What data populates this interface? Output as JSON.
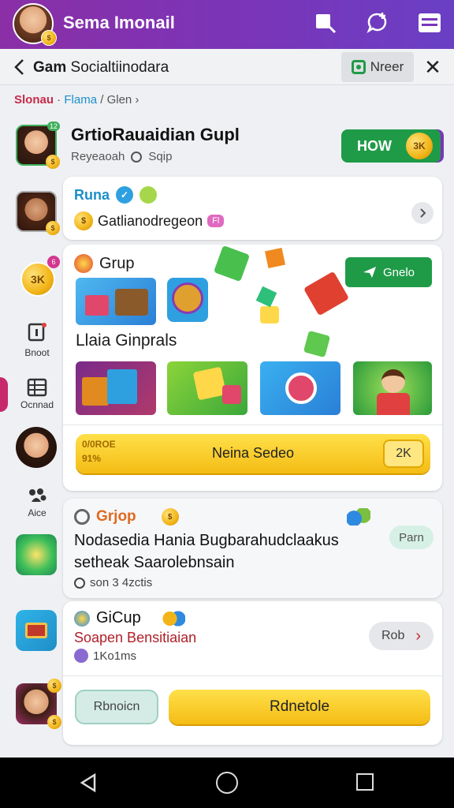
{
  "header": {
    "title": "Sema Imonail",
    "avatar_coin": "$",
    "icons": [
      "bookmark-tag-icon",
      "chat-add-icon",
      "menu-icon"
    ]
  },
  "navbar": {
    "back_icon": "chevron-left-icon",
    "title_bold": "Gam",
    "title_rest": " Socialtiinodara",
    "chip_label": "Nreer",
    "close_glyph": "✕"
  },
  "breadcrumb": {
    "part1": "Slonau",
    "sep1": " · ",
    "part2": "Flama",
    "sep2": " / ",
    "part3": "Glen",
    "arrow": " ›"
  },
  "rail": {
    "badge_top": "12",
    "coin_label": "3K",
    "badge_coin": "6",
    "item1_label": "Bnoot",
    "item2_label": "Ocnnad",
    "item3_label": "Aice"
  },
  "group_header": {
    "title": "GrtioRauaidian Gupl",
    "sub_a": "Reyeaoah",
    "sub_b": "Sqip",
    "button_label": "HOW",
    "button_coin": "3K"
  },
  "card_runa": {
    "name": "Runa",
    "message": "Gatlianodregeon",
    "badge": "Fl"
  },
  "card_group": {
    "title": "Grup",
    "subtitle": "Llaia Ginprals",
    "action_label": "Gnelo",
    "bar_left_top": "0/0ROE",
    "bar_left_bottom": "91%",
    "bar_label": "Neina Sedeo",
    "bar_button": "2K"
  },
  "card_grjop": {
    "title": "Grjop",
    "line1": "Nodasedia Hania Bugbarahudclaakus",
    "line2": "setheak Saarolebnsain",
    "meta": "son 3 4zctis",
    "pill": "Parn"
  },
  "card_gicup": {
    "title": "GiCup",
    "subtitle": "Soapen Bensitiaian",
    "meta": "1Ko1ms",
    "pill": "Rob",
    "pill_arrow": "›",
    "btn_secondary": "Rbnoicn",
    "btn_primary": "Rdnetole"
  },
  "colors": {
    "header_start": "#8a2fa6",
    "header_end": "#6a3fc4",
    "green": "#1f9b48",
    "yellow": "#f4bc14",
    "accent_red": "#c72a4a",
    "accent_blue": "#1c8fc9"
  }
}
